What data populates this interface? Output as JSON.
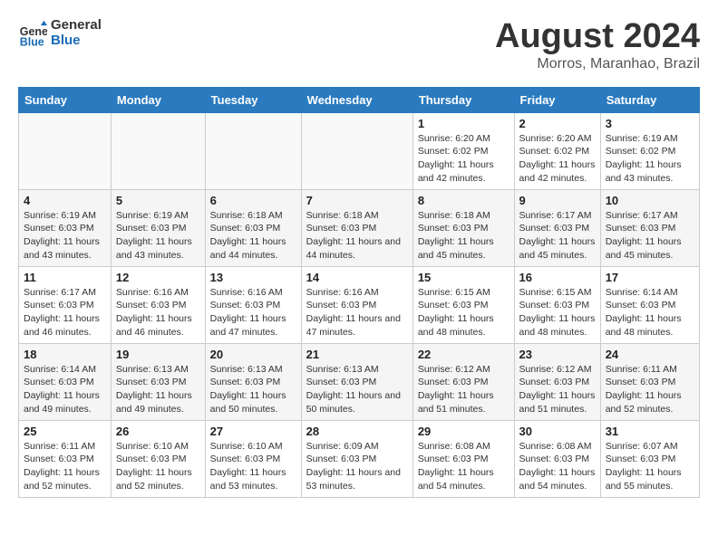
{
  "logo": {
    "line1": "General",
    "line2": "Blue"
  },
  "title": "August 2024",
  "subtitle": "Morros, Maranhao, Brazil",
  "days_of_week": [
    "Sunday",
    "Monday",
    "Tuesday",
    "Wednesday",
    "Thursday",
    "Friday",
    "Saturday"
  ],
  "rows": [
    [
      {
        "day": "",
        "info": ""
      },
      {
        "day": "",
        "info": ""
      },
      {
        "day": "",
        "info": ""
      },
      {
        "day": "",
        "info": ""
      },
      {
        "day": "1",
        "info": "Sunrise: 6:20 AM\nSunset: 6:02 PM\nDaylight: 11 hours\nand 42 minutes."
      },
      {
        "day": "2",
        "info": "Sunrise: 6:20 AM\nSunset: 6:02 PM\nDaylight: 11 hours\nand 42 minutes."
      },
      {
        "day": "3",
        "info": "Sunrise: 6:19 AM\nSunset: 6:02 PM\nDaylight: 11 hours\nand 43 minutes."
      }
    ],
    [
      {
        "day": "4",
        "info": "Sunrise: 6:19 AM\nSunset: 6:03 PM\nDaylight: 11 hours\nand 43 minutes."
      },
      {
        "day": "5",
        "info": "Sunrise: 6:19 AM\nSunset: 6:03 PM\nDaylight: 11 hours\nand 43 minutes."
      },
      {
        "day": "6",
        "info": "Sunrise: 6:18 AM\nSunset: 6:03 PM\nDaylight: 11 hours\nand 44 minutes."
      },
      {
        "day": "7",
        "info": "Sunrise: 6:18 AM\nSunset: 6:03 PM\nDaylight: 11 hours\nand 44 minutes."
      },
      {
        "day": "8",
        "info": "Sunrise: 6:18 AM\nSunset: 6:03 PM\nDaylight: 11 hours\nand 45 minutes."
      },
      {
        "day": "9",
        "info": "Sunrise: 6:17 AM\nSunset: 6:03 PM\nDaylight: 11 hours\nand 45 minutes."
      },
      {
        "day": "10",
        "info": "Sunrise: 6:17 AM\nSunset: 6:03 PM\nDaylight: 11 hours\nand 45 minutes."
      }
    ],
    [
      {
        "day": "11",
        "info": "Sunrise: 6:17 AM\nSunset: 6:03 PM\nDaylight: 11 hours\nand 46 minutes."
      },
      {
        "day": "12",
        "info": "Sunrise: 6:16 AM\nSunset: 6:03 PM\nDaylight: 11 hours\nand 46 minutes."
      },
      {
        "day": "13",
        "info": "Sunrise: 6:16 AM\nSunset: 6:03 PM\nDaylight: 11 hours\nand 47 minutes."
      },
      {
        "day": "14",
        "info": "Sunrise: 6:16 AM\nSunset: 6:03 PM\nDaylight: 11 hours\nand 47 minutes."
      },
      {
        "day": "15",
        "info": "Sunrise: 6:15 AM\nSunset: 6:03 PM\nDaylight: 11 hours\nand 48 minutes."
      },
      {
        "day": "16",
        "info": "Sunrise: 6:15 AM\nSunset: 6:03 PM\nDaylight: 11 hours\nand 48 minutes."
      },
      {
        "day": "17",
        "info": "Sunrise: 6:14 AM\nSunset: 6:03 PM\nDaylight: 11 hours\nand 48 minutes."
      }
    ],
    [
      {
        "day": "18",
        "info": "Sunrise: 6:14 AM\nSunset: 6:03 PM\nDaylight: 11 hours\nand 49 minutes."
      },
      {
        "day": "19",
        "info": "Sunrise: 6:13 AM\nSunset: 6:03 PM\nDaylight: 11 hours\nand 49 minutes."
      },
      {
        "day": "20",
        "info": "Sunrise: 6:13 AM\nSunset: 6:03 PM\nDaylight: 11 hours\nand 50 minutes."
      },
      {
        "day": "21",
        "info": "Sunrise: 6:13 AM\nSunset: 6:03 PM\nDaylight: 11 hours\nand 50 minutes."
      },
      {
        "day": "22",
        "info": "Sunrise: 6:12 AM\nSunset: 6:03 PM\nDaylight: 11 hours\nand 51 minutes."
      },
      {
        "day": "23",
        "info": "Sunrise: 6:12 AM\nSunset: 6:03 PM\nDaylight: 11 hours\nand 51 minutes."
      },
      {
        "day": "24",
        "info": "Sunrise: 6:11 AM\nSunset: 6:03 PM\nDaylight: 11 hours\nand 52 minutes."
      }
    ],
    [
      {
        "day": "25",
        "info": "Sunrise: 6:11 AM\nSunset: 6:03 PM\nDaylight: 11 hours\nand 52 minutes."
      },
      {
        "day": "26",
        "info": "Sunrise: 6:10 AM\nSunset: 6:03 PM\nDaylight: 11 hours\nand 52 minutes."
      },
      {
        "day": "27",
        "info": "Sunrise: 6:10 AM\nSunset: 6:03 PM\nDaylight: 11 hours\nand 53 minutes."
      },
      {
        "day": "28",
        "info": "Sunrise: 6:09 AM\nSunset: 6:03 PM\nDaylight: 11 hours\nand 53 minutes."
      },
      {
        "day": "29",
        "info": "Sunrise: 6:08 AM\nSunset: 6:03 PM\nDaylight: 11 hours\nand 54 minutes."
      },
      {
        "day": "30",
        "info": "Sunrise: 6:08 AM\nSunset: 6:03 PM\nDaylight: 11 hours\nand 54 minutes."
      },
      {
        "day": "31",
        "info": "Sunrise: 6:07 AM\nSunset: 6:03 PM\nDaylight: 11 hours\nand 55 minutes."
      }
    ]
  ]
}
